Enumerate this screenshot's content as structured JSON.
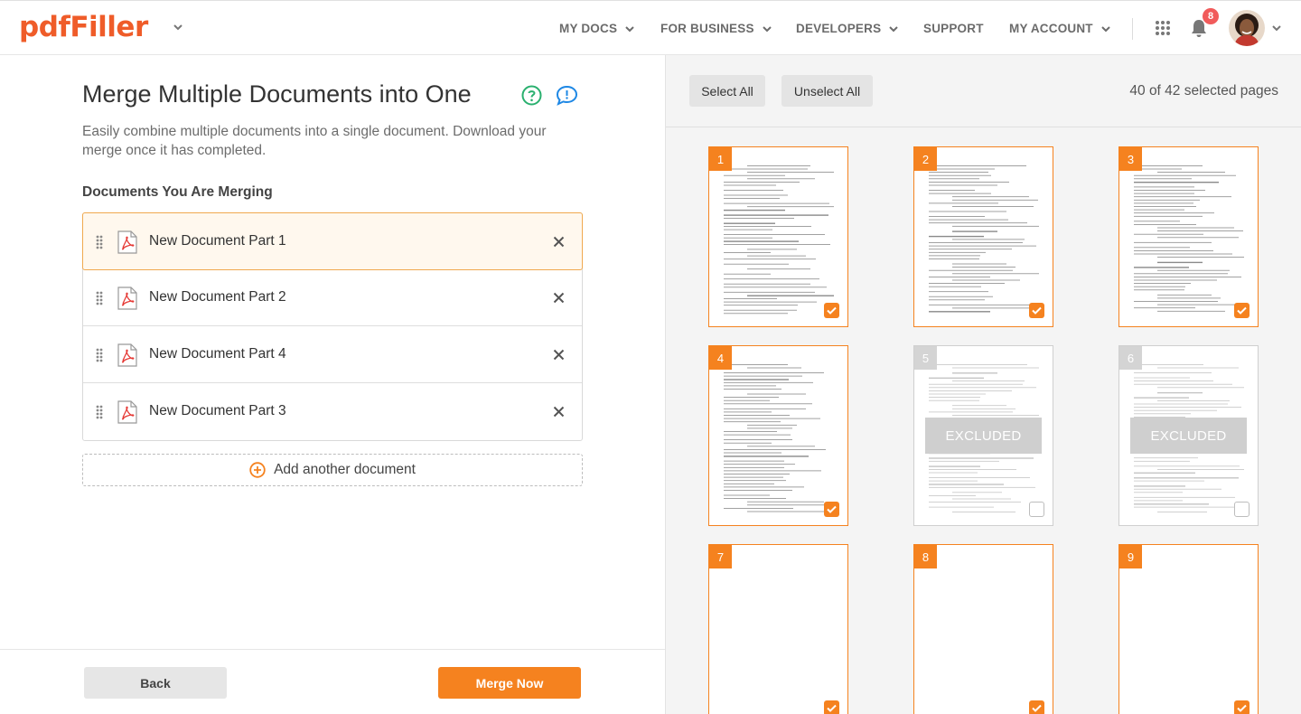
{
  "header": {
    "logo": "pdfFiller",
    "nav": [
      {
        "label": "MY DOCS",
        "has_caret": true
      },
      {
        "label": "FOR BUSINESS",
        "has_caret": true
      },
      {
        "label": "DEVELOPERS",
        "has_caret": true
      },
      {
        "label": "SUPPORT",
        "has_caret": false
      },
      {
        "label": "MY ACCOUNT",
        "has_caret": true
      }
    ],
    "notification_count": "8",
    "icons": [
      "apps-grid-icon",
      "bell-icon",
      "avatar",
      "chevron-down-icon"
    ]
  },
  "left": {
    "title": "Merge Multiple Documents into One",
    "description": "Easily combine multiple documents into a single document. Download your merge once it has completed.",
    "section_label": "Documents You Are Merging",
    "documents": [
      {
        "name": "New Document Part 1",
        "active": true
      },
      {
        "name": "New Document Part 2",
        "active": false
      },
      {
        "name": "New Document Part 4",
        "active": false
      },
      {
        "name": "New Document Part 3",
        "active": false
      }
    ],
    "add_label": "Add another document",
    "back_label": "Back",
    "merge_label": "Merge Now"
  },
  "right": {
    "select_all": "Select All",
    "unselect_all": "Unselect All",
    "selected_text": "40 of 42 selected pages",
    "excluded_label": "EXCLUDED",
    "pages": [
      {
        "num": "1",
        "selected": true
      },
      {
        "num": "2",
        "selected": true
      },
      {
        "num": "3",
        "selected": true
      },
      {
        "num": "4",
        "selected": true
      },
      {
        "num": "5",
        "selected": false
      },
      {
        "num": "6",
        "selected": false
      },
      {
        "num": "7",
        "selected": true
      },
      {
        "num": "8",
        "selected": true
      },
      {
        "num": "9",
        "selected": true
      }
    ]
  },
  "colors": {
    "brand": "#ef5c29",
    "accent": "#f5821f",
    "badge": "#f15b5b"
  }
}
